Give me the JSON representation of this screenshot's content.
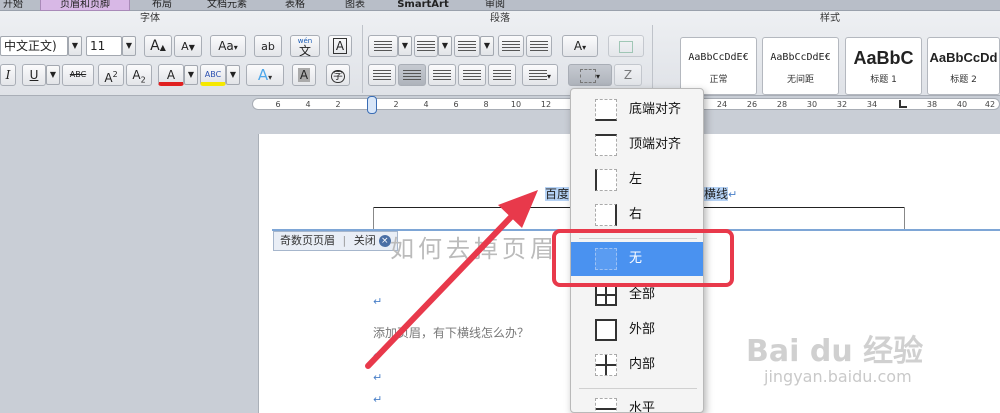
{
  "tabs": [
    "开始",
    "页眉和页脚",
    "布局",
    "文档元素",
    "表格",
    "图表",
    "SmartArt",
    "审阅"
  ],
  "ribbon": {
    "font_group_title": "字体",
    "paragraph_group_title": "段落",
    "styles_group_title": "样式",
    "font_name": "中文正文)",
    "font_size": "11",
    "grow_font": "A",
    "shrink_font": "A",
    "change_case": "Aa",
    "phonetic": "文",
    "phonetic_top": "wén",
    "char_border": "A",
    "italic": "I",
    "underline": "U",
    "strikethrough": "ABC",
    "superscript": "A",
    "superscript_mark": "2",
    "subscript": "A",
    "subscript_mark": "2",
    "font_color": "A",
    "highlight": "ABC",
    "text_effect": "A",
    "char_shading": "A",
    "enclose_char": "字",
    "sort_icon": "A",
    "sort_icon_sub": "Z",
    "styles": [
      {
        "sample": "AaBbCcDdE€",
        "name": "正常"
      },
      {
        "sample": "AaBbCcDdE€",
        "name": "无间距"
      },
      {
        "sample": "AaBbC",
        "name": "标题 1"
      },
      {
        "sample": "AaBbCcDd",
        "name": "标题 2"
      }
    ]
  },
  "ruler": [
    "6",
    "4",
    "2",
    "2",
    "4",
    "6",
    "8",
    "10",
    "12",
    "24",
    "26",
    "28",
    "30",
    "32",
    "34",
    "38",
    "40",
    "42"
  ],
  "document": {
    "header_text": "百度",
    "header_text_end": "横线",
    "odd_page_header_label": "奇数页页眉",
    "close_label": "关闭",
    "title": "如何去掉页眉",
    "body_line": "添加页眉，有下横线怎么办？",
    "paragraph_mark": "↵"
  },
  "border_menu": {
    "items": [
      "底端对齐",
      "顶端对齐",
      "左",
      "右",
      "无",
      "全部",
      "外部",
      "内部",
      "水平"
    ],
    "selected": "无"
  },
  "watermark": {
    "logo": "Bai du 经验",
    "url": "jingyan.baidu.com"
  },
  "colors": {
    "callout": "#e8394b",
    "selected_item": "#4a92f0",
    "font_color_bar": "#e02020",
    "highlight_bar": "#f5e800"
  }
}
